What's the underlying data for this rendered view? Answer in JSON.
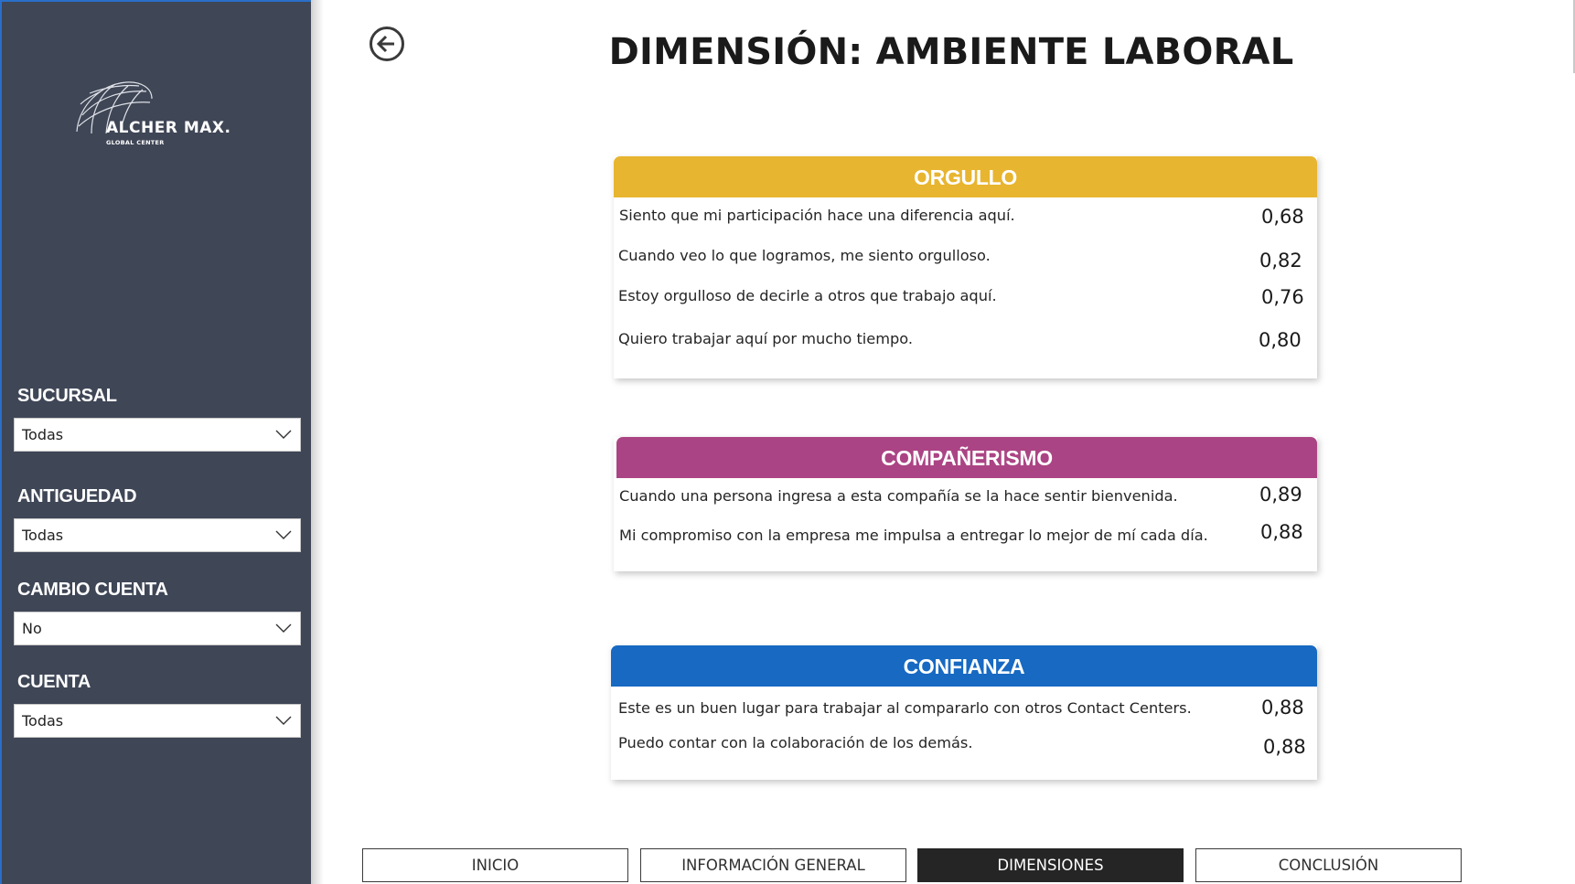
{
  "brand": {
    "name": "ALCHER MAX.",
    "tagline": "GLOBAL CENTER"
  },
  "filters": [
    {
      "label": "SUCURSAL",
      "value": "Todas"
    },
    {
      "label": "ANTIGUEDAD",
      "value": "Todas"
    },
    {
      "label": "CAMBIO CUENTA",
      "value": "No"
    },
    {
      "label": "CUENTA",
      "value": "Todas"
    }
  ],
  "page": {
    "title": "DIMENSIÓN: AMBIENTE LABORAL"
  },
  "cards": [
    {
      "title": "ORGULLO",
      "color": "#e8b530",
      "items": [
        {
          "text": "Siento que mi participación hace una diferencia aquí.",
          "value": "0,68"
        },
        {
          "text": "Cuando veo lo que logramos, me siento orgulloso.",
          "value": "0,82"
        },
        {
          "text": "Estoy orgulloso de decirle a otros que trabajo aquí.",
          "value": "0,76"
        },
        {
          "text": "Quiero trabajar aquí por mucho tiempo.",
          "value": "0,80"
        }
      ]
    },
    {
      "title": "COMPAÑERISMO",
      "color": "#ab4484",
      "items": [
        {
          "text": "Cuando una persona ingresa a esta compañía se la hace sentir bienvenida.",
          "value": "0,89"
        },
        {
          "text": "Mi compromiso con la empresa me impulsa a entregar lo mejor de mí cada día.",
          "value": "0,88"
        }
      ]
    },
    {
      "title": "CONFIANZA",
      "color": "#1769c2",
      "items": [
        {
          "text": "Este es un buen lugar para trabajar al compararlo con otros Contact Centers.",
          "value": "0,88"
        },
        {
          "text": "Puedo contar con la colaboración de los demás.",
          "value": "0,88"
        }
      ]
    }
  ],
  "nav": [
    {
      "label": "INICIO",
      "active": false
    },
    {
      "label": "INFORMACIÓN GENERAL",
      "active": false
    },
    {
      "label": "DIMENSIONES",
      "active": true
    },
    {
      "label": "CONCLUSIÓN",
      "active": false
    }
  ]
}
